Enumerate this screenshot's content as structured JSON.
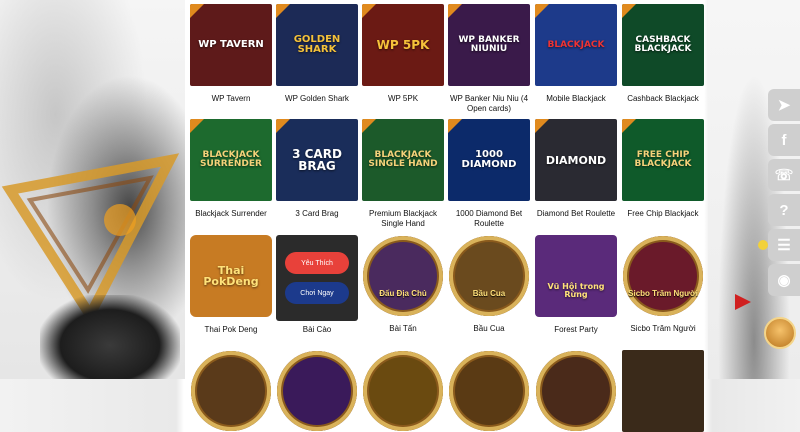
{
  "row1": [
    {
      "name": "WP Tavern",
      "art": "WP TAVERN",
      "bg": "#5e1a1a"
    },
    {
      "name": "WP Golden Shark",
      "art": "GOLDEN SHARK",
      "bg": "#1c2a56"
    },
    {
      "name": "WP 5PK",
      "art": "WP 5PK",
      "bg": "#6b1a14"
    },
    {
      "name": "WP Banker Niu Niu (4 Open cards)",
      "art": "WP BANKER NIUNIU",
      "bg": "#3a1a4a"
    },
    {
      "name": "Mobile Blackjack",
      "art": "BLACKJACK",
      "bg": "#1d3a8a"
    },
    {
      "name": "Cashback Blackjack",
      "art": "CASHBACK BLACKJACK",
      "bg": "#0f4a28"
    }
  ],
  "row2": [
    {
      "name": "Blackjack Surrender",
      "art": "BLACKJACK SURRENDER",
      "bg": "#1d6a2e"
    },
    {
      "name": "3 Card Brag",
      "art": "3 CARD BRAG",
      "bg": "#1a2d5a"
    },
    {
      "name": "Premium Blackjack Single Hand",
      "art": "BLACKJACK SINGLE HAND",
      "bg": "#1c5a2a"
    },
    {
      "name": "1000 Diamond Bet Roulette",
      "art": "1000 DIAMOND",
      "bg": "#0c2a6a"
    },
    {
      "name": "Diamond Bet Roulette",
      "art": "DIAMOND",
      "bg": "#2a2a32"
    },
    {
      "name": "Free Chip Blackjack",
      "art": "FREE CHIP BLACKJACK",
      "bg": "#0f5a2a"
    }
  ],
  "row3": [
    {
      "name": "Thai Pok Deng",
      "art": "Thai PokDeng",
      "bg": "#c77b23"
    },
    {
      "name": "Bài Cào",
      "hover": true,
      "btn1": "Yêu Thích",
      "btn2": "Chơi Ngay"
    },
    {
      "name": "Bài Tấn",
      "lbl": "Đấu Địa Chủ",
      "bg": "#4a2a5e"
    },
    {
      "name": "Bầu Cua",
      "lbl": "Bầu Cua",
      "bg": "#6a4a1e"
    },
    {
      "name": "Forest Party",
      "lbl": "Vũ Hội trong Rừng",
      "bg": "#5a2a7a"
    },
    {
      "name": "Sicbo Trăm Người",
      "lbl": "Sicbo Trăm Người",
      "bg": "#6a1a2a"
    }
  ],
  "side_icons": [
    "telegram-icon",
    "facebook-icon",
    "phone-icon",
    "help-icon",
    "news-icon",
    "eye-icon"
  ],
  "side_glyphs": [
    "➤",
    "f",
    "☏",
    "?",
    "☰",
    "◉"
  ]
}
